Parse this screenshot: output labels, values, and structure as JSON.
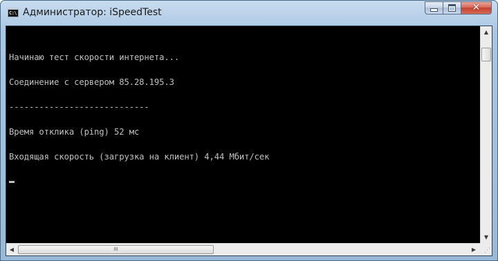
{
  "window": {
    "title": "Администратор: iSpeedTest",
    "app_icon_label": "C:\\",
    "buttons": {
      "minimize_icon": "minimize-icon",
      "maximize_icon": "maximize-icon",
      "close_glyph": "✕"
    }
  },
  "console": {
    "lines": [
      "Начинаю тест скорости интернета...",
      "Соединение с сервером 85.28.195.3",
      "----------------------------",
      "Время отклика (ping) 52 мс",
      "Входящая скорость (загрузка на клиент) 4,44 Мбит/сек"
    ]
  },
  "scrollbars": {
    "up_arrow": "▲",
    "down_arrow": "▼",
    "left_arrow": "◀",
    "right_arrow": "▶",
    "thumb_grip": "III",
    "size_grip": "⋰"
  },
  "colors": {
    "console_bg": "#000000",
    "console_text": "#c0c0c0",
    "close_button": "#c4412f",
    "frame": "#a9c6e3"
  }
}
